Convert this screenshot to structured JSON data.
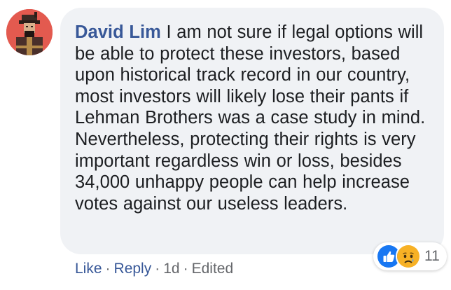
{
  "comment": {
    "author": "David Lim",
    "text": "I am not sure if legal options will be able to protect these investors, based upon historical track record in our country, most investors will likely lose their pants if Lehman Brothers was a case study in mind. Nevertheless, protecting their rights is very important regardless win or loss, besides 34,000 unhappy people can help increase votes against our useless leaders."
  },
  "reactions": {
    "icons": [
      "like-icon",
      "sad-icon"
    ],
    "count": "11"
  },
  "actions": {
    "like_label": "Like",
    "reply_label": "Reply",
    "separator": "·",
    "timestamp": "1d",
    "edited_label": "Edited"
  },
  "colors": {
    "bubble_bg": "#f0f2f5",
    "author_link": "#385898",
    "text": "#1c1e21",
    "meta": "#65676b",
    "like_blue": "#1877f2",
    "sad_yellow": "#f7b125"
  }
}
